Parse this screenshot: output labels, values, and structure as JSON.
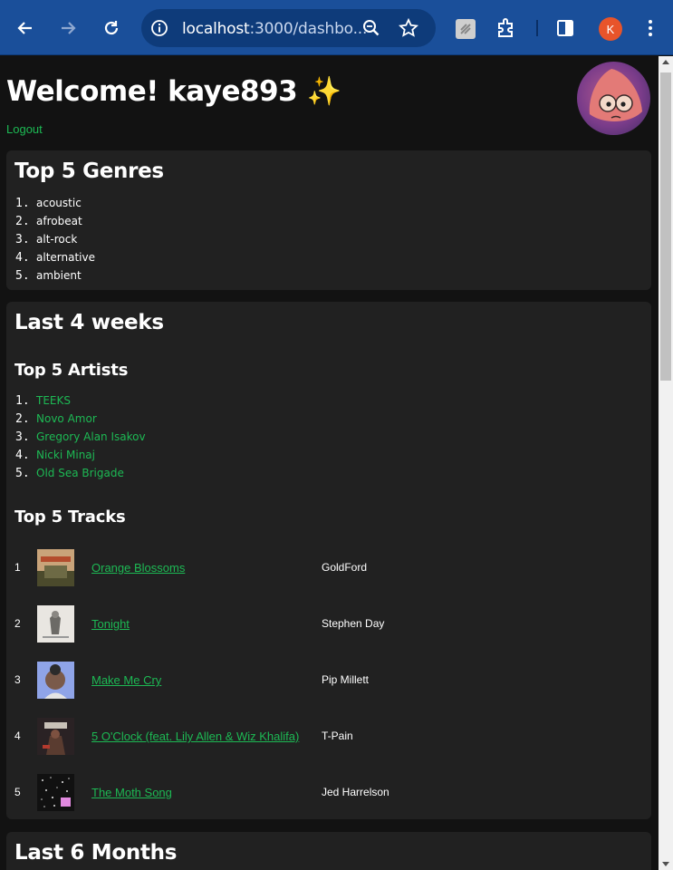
{
  "browser": {
    "url_host": "localhost",
    "url_rest": ":3000/dashbo...",
    "profile_initial": "K"
  },
  "header": {
    "welcome": "Welcome! kaye893 ✨",
    "logout": "Logout"
  },
  "genres": {
    "title": "Top 5 Genres",
    "items": [
      "acoustic",
      "afrobeat",
      "alt-rock",
      "alternative",
      "ambient"
    ]
  },
  "short_term": {
    "title": "Last 4 weeks",
    "artists_title": "Top 5 Artists",
    "artists": [
      "TEEKS",
      "Novo Amor",
      "Gregory Alan Isakov",
      "Nicki Minaj",
      "Old Sea Brigade"
    ],
    "tracks_title": "Top 5 Tracks",
    "tracks": [
      {
        "rank": "1",
        "title": "Orange Blossoms",
        "artist": "GoldFord",
        "art": "goldford"
      },
      {
        "rank": "2",
        "title": "Tonight",
        "artist": "Stephen Day",
        "art": "stephen"
      },
      {
        "rank": "3",
        "title": "Make Me Cry",
        "artist": "Pip Millett",
        "art": "pip"
      },
      {
        "rank": "4",
        "title": "5 O'Clock (feat. Lily Allen & Wiz Khalifa)",
        "artist": "T-Pain",
        "art": "tpain"
      },
      {
        "rank": "5",
        "title": "The Moth Song",
        "artist": "Jed Harrelson",
        "art": "moth"
      }
    ]
  },
  "medium_term": {
    "title": "Last 6 Months"
  },
  "numbers": {
    "g1": "1.",
    "g2": "2.",
    "g3": "3.",
    "g4": "4.",
    "g5": "5."
  }
}
